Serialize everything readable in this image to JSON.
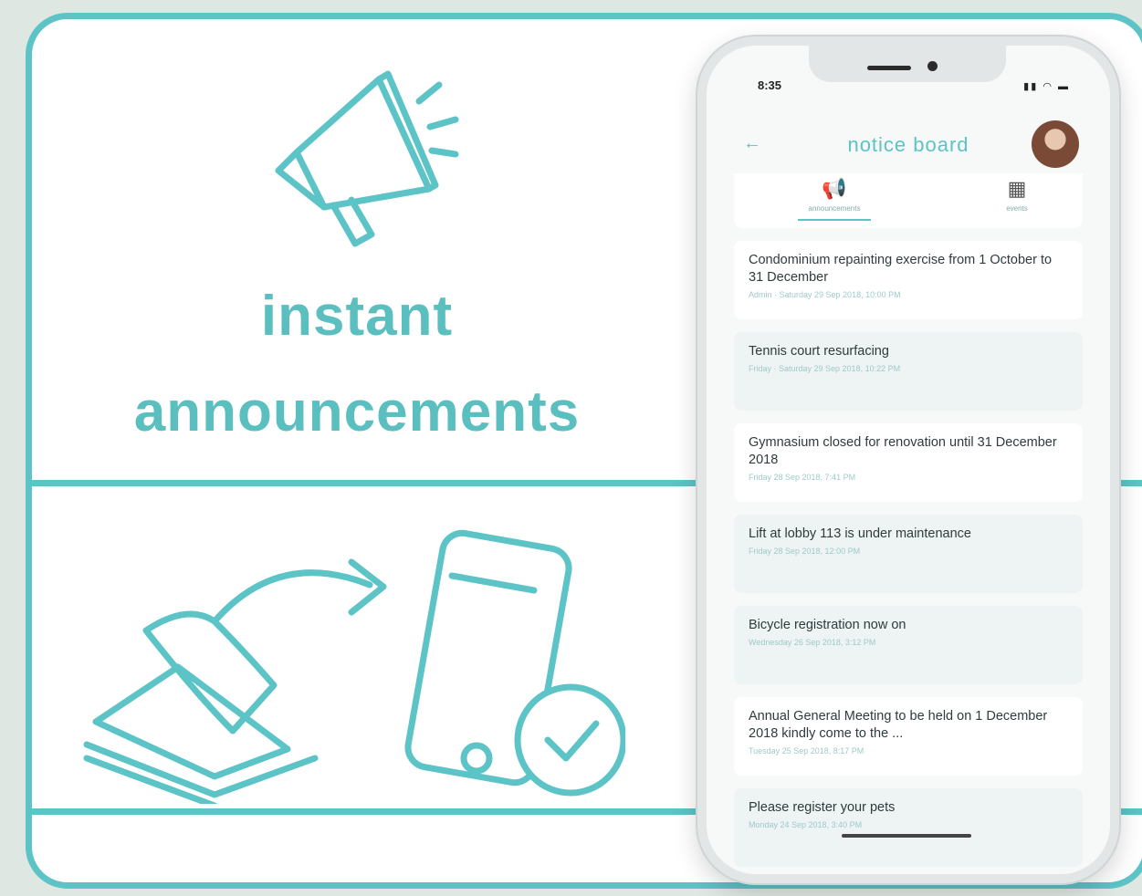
{
  "headline": {
    "line1": "instant",
    "line2": "announcements"
  },
  "phone": {
    "status_time": "8:35",
    "status_icons": "▮▮ ◠ ▬",
    "screen_title": "notice board",
    "tabs": [
      {
        "label": "announcements",
        "icon": "megaphone-icon"
      },
      {
        "label": "events",
        "icon": "calendar-icon"
      }
    ],
    "notices": [
      {
        "title": "Condominium repainting exercise from 1 October to 31 December",
        "meta": "Admin · Saturday 29 Sep 2018, 10:00 PM"
      },
      {
        "title": "Tennis court resurfacing",
        "meta": "Friday · Saturday 29 Sep 2018, 10:22 PM"
      },
      {
        "title": "Gymnasium closed for renovation until 31 December 2018",
        "meta": "Friday 28 Sep 2018, 7:41 PM"
      },
      {
        "title": "Lift at lobby 113 is under maintenance",
        "meta": "Friday 28 Sep 2018, 12:00 PM"
      },
      {
        "title": "Bicycle registration now on",
        "meta": "Wednesday 26 Sep 2018, 3:12 PM"
      },
      {
        "title": "Annual General Meeting to be held on 1 December 2018 kindly come to the ...",
        "meta": "Tuesday 25 Sep 2018, 8:17 PM"
      },
      {
        "title": "Please register your pets",
        "meta": "Monday 24 Sep 2018, 3:40 PM"
      }
    ]
  },
  "colors": {
    "accent": "#5cc3c6",
    "text": "#2f3b3c"
  }
}
